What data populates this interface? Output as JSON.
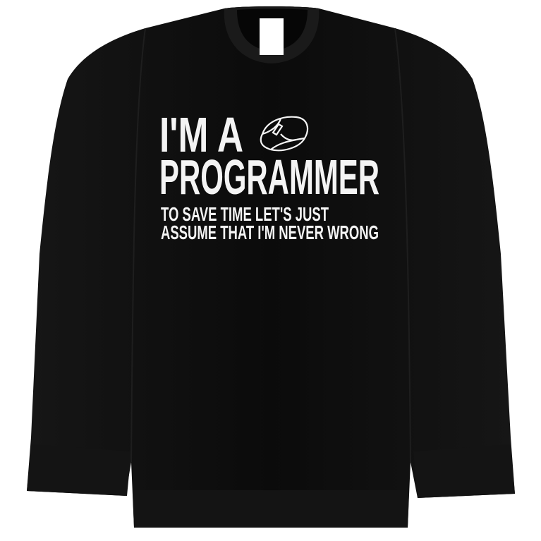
{
  "product": {
    "type": "crewneck sweatshirt",
    "garment_color": "#0c0c0c",
    "print_color": "#f4f4f4",
    "print": {
      "line1": "I'M A",
      "line2": "PROGRAMMER",
      "line3": "TO SAVE TIME LET'S JUST",
      "line4": "ASSUME THAT I'M NEVER WRONG",
      "graphic": "computer-mouse-icon"
    }
  }
}
